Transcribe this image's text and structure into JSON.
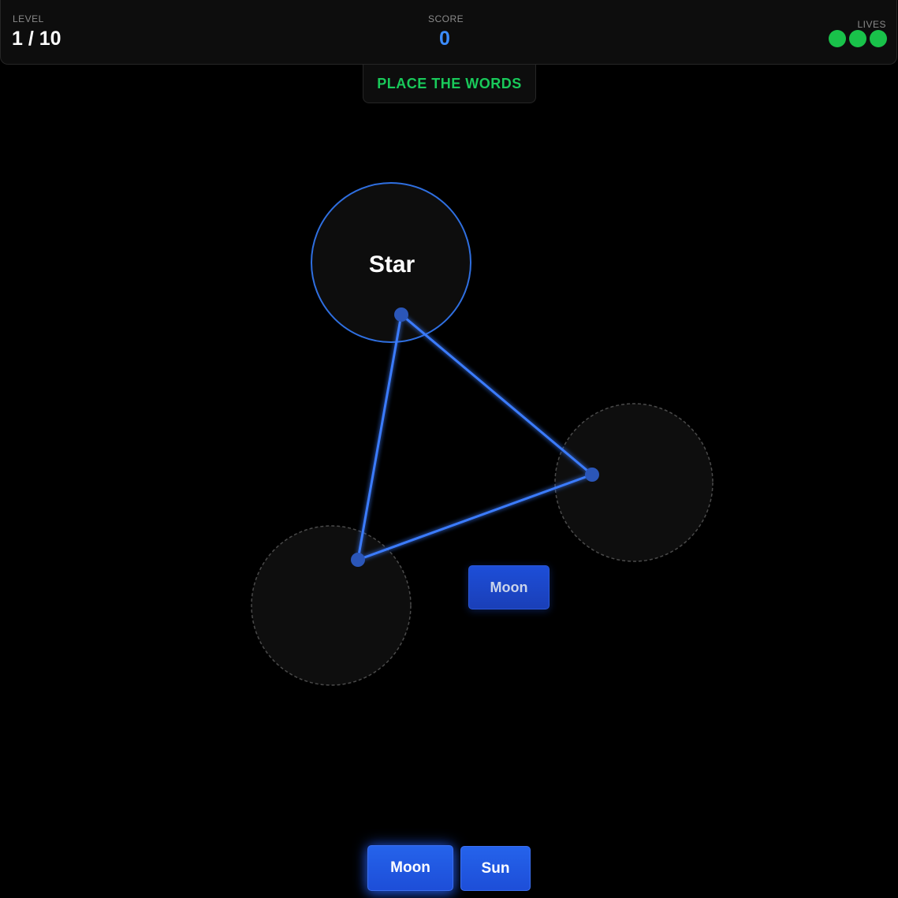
{
  "hud": {
    "level_label": "LEVEL",
    "level_value": "1 / 10",
    "score_label": "SCORE",
    "score_value": "0",
    "lives_label": "LIVES",
    "lives_count": 3
  },
  "banner": {
    "text": "PLACE THE WORDS"
  },
  "nodes": [
    {
      "id": "top",
      "word": "Star",
      "filled": true
    },
    {
      "id": "right",
      "word": "",
      "filled": false
    },
    {
      "id": "left",
      "word": "",
      "filled": false
    }
  ],
  "dragging_chip": {
    "label": "Moon"
  },
  "tray": {
    "words": [
      "Moon",
      "Sun"
    ]
  },
  "colors": {
    "accent_blue": "#3b82f6",
    "lives_green": "#19c24a",
    "banner_green": "#19c95a",
    "score_blue": "#3b8cff"
  },
  "icons": {
    "life": "life-dot-icon"
  }
}
